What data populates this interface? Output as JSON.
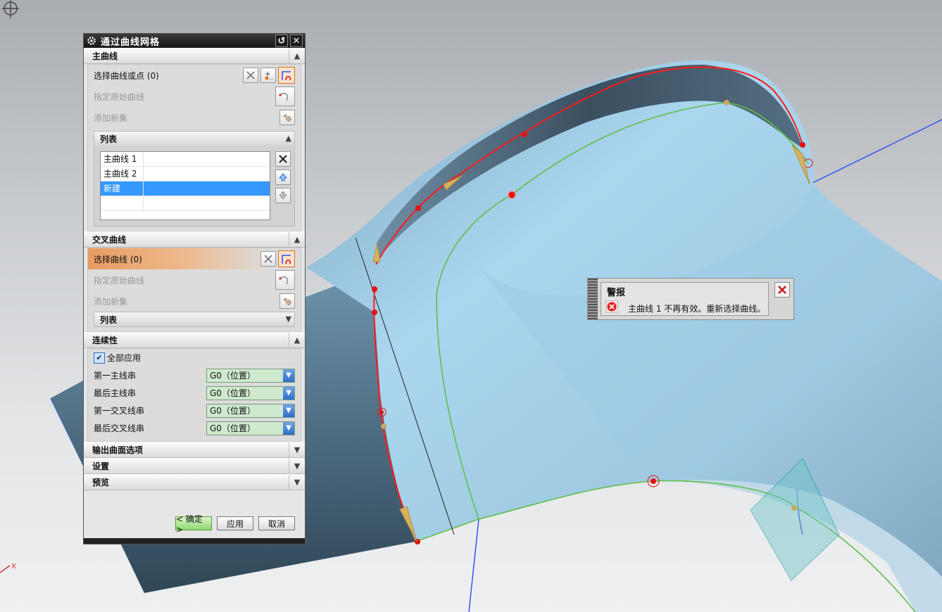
{
  "dialog": {
    "title": "通过曲线网格",
    "primary": {
      "header": "主曲线",
      "select_label": "选择曲线或点 (0)",
      "specify_label": "指定原始曲线",
      "add_label": "添加新集",
      "list": {
        "header": "列表",
        "items": [
          "主曲线 1",
          "主曲线 2",
          "新建"
        ]
      }
    },
    "cross": {
      "header": "交叉曲线",
      "select_label": "选择曲线 (0)",
      "specify_label": "指定原始曲线",
      "add_label": "添加新集",
      "list_header": "列表"
    },
    "continuity": {
      "header": "连续性",
      "apply_all": "全部应用",
      "rows": [
        {
          "label": "第一主线串",
          "value": "G0（位置）"
        },
        {
          "label": "最后主线串",
          "value": "G0（位置）"
        },
        {
          "label": "第一交叉线串",
          "value": "G0（位置）"
        },
        {
          "label": "最后交叉线串",
          "value": "G0（位置）"
        }
      ]
    },
    "collapsed_sections": [
      "输出曲面选项",
      "设置",
      "预览"
    ],
    "buttons": {
      "ok": "< 确定 >",
      "apply": "应用",
      "cancel": "取消"
    }
  },
  "alert": {
    "title": "警报",
    "message": "主曲线 1 不再有效。重新选择曲线。"
  },
  "axis_label": "X",
  "colors": {
    "surface": "#a9d4ea",
    "curve": "#ff1a1a",
    "edge": "#5fbf4a",
    "line": "#3355ee",
    "highlight": "#3399ff"
  }
}
